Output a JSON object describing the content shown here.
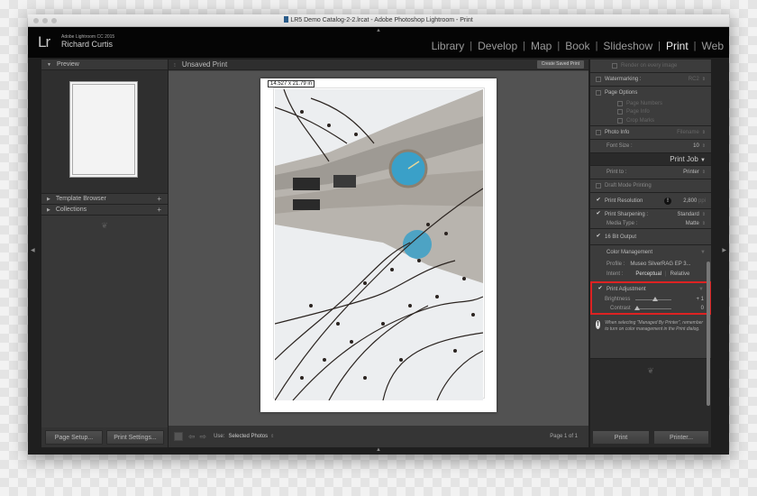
{
  "window": {
    "title": "LR5 Demo Catalog-2-2.lrcat - Adobe Photoshop Lightroom - Print"
  },
  "identity": {
    "logo": "Lr",
    "app_version": "Adobe Lightroom CC 2015",
    "user_name": "Richard Curtis"
  },
  "modules": [
    {
      "label": "Library",
      "active": false
    },
    {
      "label": "Develop",
      "active": false
    },
    {
      "label": "Map",
      "active": false
    },
    {
      "label": "Book",
      "active": false
    },
    {
      "label": "Slideshow",
      "active": false
    },
    {
      "label": "Print",
      "active": true
    },
    {
      "label": "Web",
      "active": false
    }
  ],
  "left_panel": {
    "preview_label": "Preview",
    "template_browser_label": "Template Browser",
    "collections_label": "Collections",
    "page_setup_button": "Page Setup...",
    "print_settings_button": "Print Settings..."
  },
  "center": {
    "title": "Unsaved Print",
    "create_saved_print": "Create Saved Print",
    "dimension_label": "14.527 x 21.79 in",
    "toolbar": {
      "use_label": "Use:",
      "use_value": "Selected Photos",
      "page_count": "Page 1 of 1"
    }
  },
  "right_panel": {
    "render_every_image": "Render on every image",
    "watermarking": {
      "label": "Watermarking :",
      "value": "RC2"
    },
    "page_options": {
      "label": "Page Options",
      "items": [
        "Page Numbers",
        "Page Info",
        "Crop Marks"
      ]
    },
    "photo_info": {
      "label": "Photo Info",
      "value": "Filename"
    },
    "font_size": {
      "label": "Font Size :",
      "value": "10"
    },
    "print_job": {
      "header": "Print Job",
      "print_to": {
        "label": "Print to :",
        "value": "Printer"
      },
      "draft_mode": "Draft Mode Printing",
      "print_resolution": {
        "label": "Print Resolution",
        "value": "2,800",
        "unit": "ppi"
      },
      "print_sharpening": {
        "label": "Print Sharpening :",
        "value": "Standard"
      },
      "media_type": {
        "label": "Media Type :",
        "value": "Matte"
      },
      "bit_output": "16 Bit Output",
      "color_management": {
        "label": "Color Management",
        "profile_label": "Profile :",
        "profile_value": "Museo SilverRAG EP 3...",
        "intent_label": "Intent :",
        "intent_options": [
          "Perceptual",
          "Relative"
        ]
      },
      "print_adjustment": {
        "label": "Print Adjustment",
        "brightness": {
          "label": "Brightness",
          "value": "+ 1",
          "level": 0.55
        },
        "contrast": {
          "label": "Contrast",
          "value": "0",
          "level": 0.05
        }
      },
      "warning": "When selecting \"Managed By Printer\", remember to turn on color management in the Print dialog."
    },
    "print_button": "Print",
    "printer_button": "Printer..."
  },
  "colors": {
    "highlight": "#dd2222",
    "clock_face": "#3aa0c8"
  }
}
